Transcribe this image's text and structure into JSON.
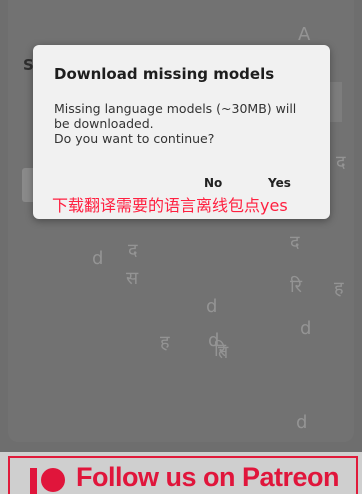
{
  "background": {
    "partial_label": "S",
    "glyphs": [
      "A",
      "द",
      "द",
      "द",
      "स",
      "ह",
      "ह",
      "त",
      "रि",
      "रि",
      "d",
      "d",
      "d",
      "d",
      "d",
      "द"
    ]
  },
  "dialog": {
    "title": "Download missing models",
    "message": "Missing language models (~30MB) will\nbe downloaded.\nDo you want to continue?",
    "no_label": "No",
    "yes_label": "Yes",
    "annotation": "下载翻译需要的语言离线包点yes"
  },
  "banner": {
    "text": "Follow us on Patreon"
  },
  "colors": {
    "annotation": "#ff2040",
    "patreon_red": "#e0153b"
  },
  "icons": [
    "patreon-logo-icon"
  ]
}
